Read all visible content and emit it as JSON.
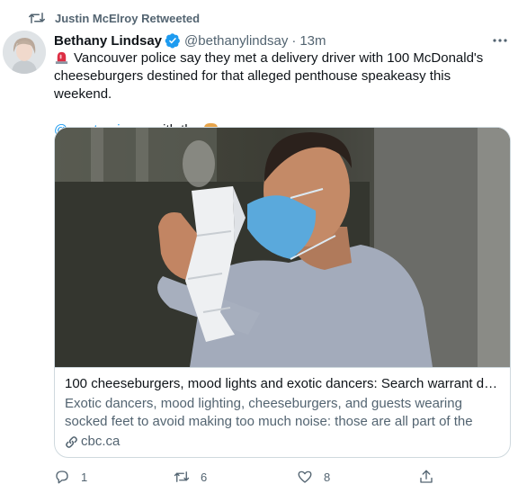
{
  "retweet_context": {
    "icon": "retweet-icon",
    "text": "Justin McElroy Retweeted"
  },
  "author": {
    "name": "Bethany Lindsay",
    "verified_icon": "verified-badge-icon",
    "handle": "@bethanylindsay",
    "separator": "·",
    "time": "13m"
  },
  "tweet": {
    "text_main": "Vancouver police say they met a delivery driver with 100 McDonald's cheeseburgers destined for that alleged penthouse speakeasy this weekend.",
    "mention": "@proctor_jason",
    "text_after_mention": " with the",
    "leading_emoji": "police-siren-emoji",
    "trailing_emoji": "hamburger-emoji"
  },
  "card": {
    "title": "100 cheeseburgers, mood lights and exotic dancers: Search warrant det...",
    "description": "Exotic dancers, mood lighting, cheeseburgers, and guests wearing socked feet to avoid making too much noise: those are all part of the details ...",
    "domain": "cbc.ca"
  },
  "actions": {
    "reply_count": "1",
    "retweet_count": "6",
    "like_count": "8"
  },
  "colors": {
    "accent": "#1d9bf0",
    "secondary_text": "#536471",
    "border": "#cfd9de"
  }
}
